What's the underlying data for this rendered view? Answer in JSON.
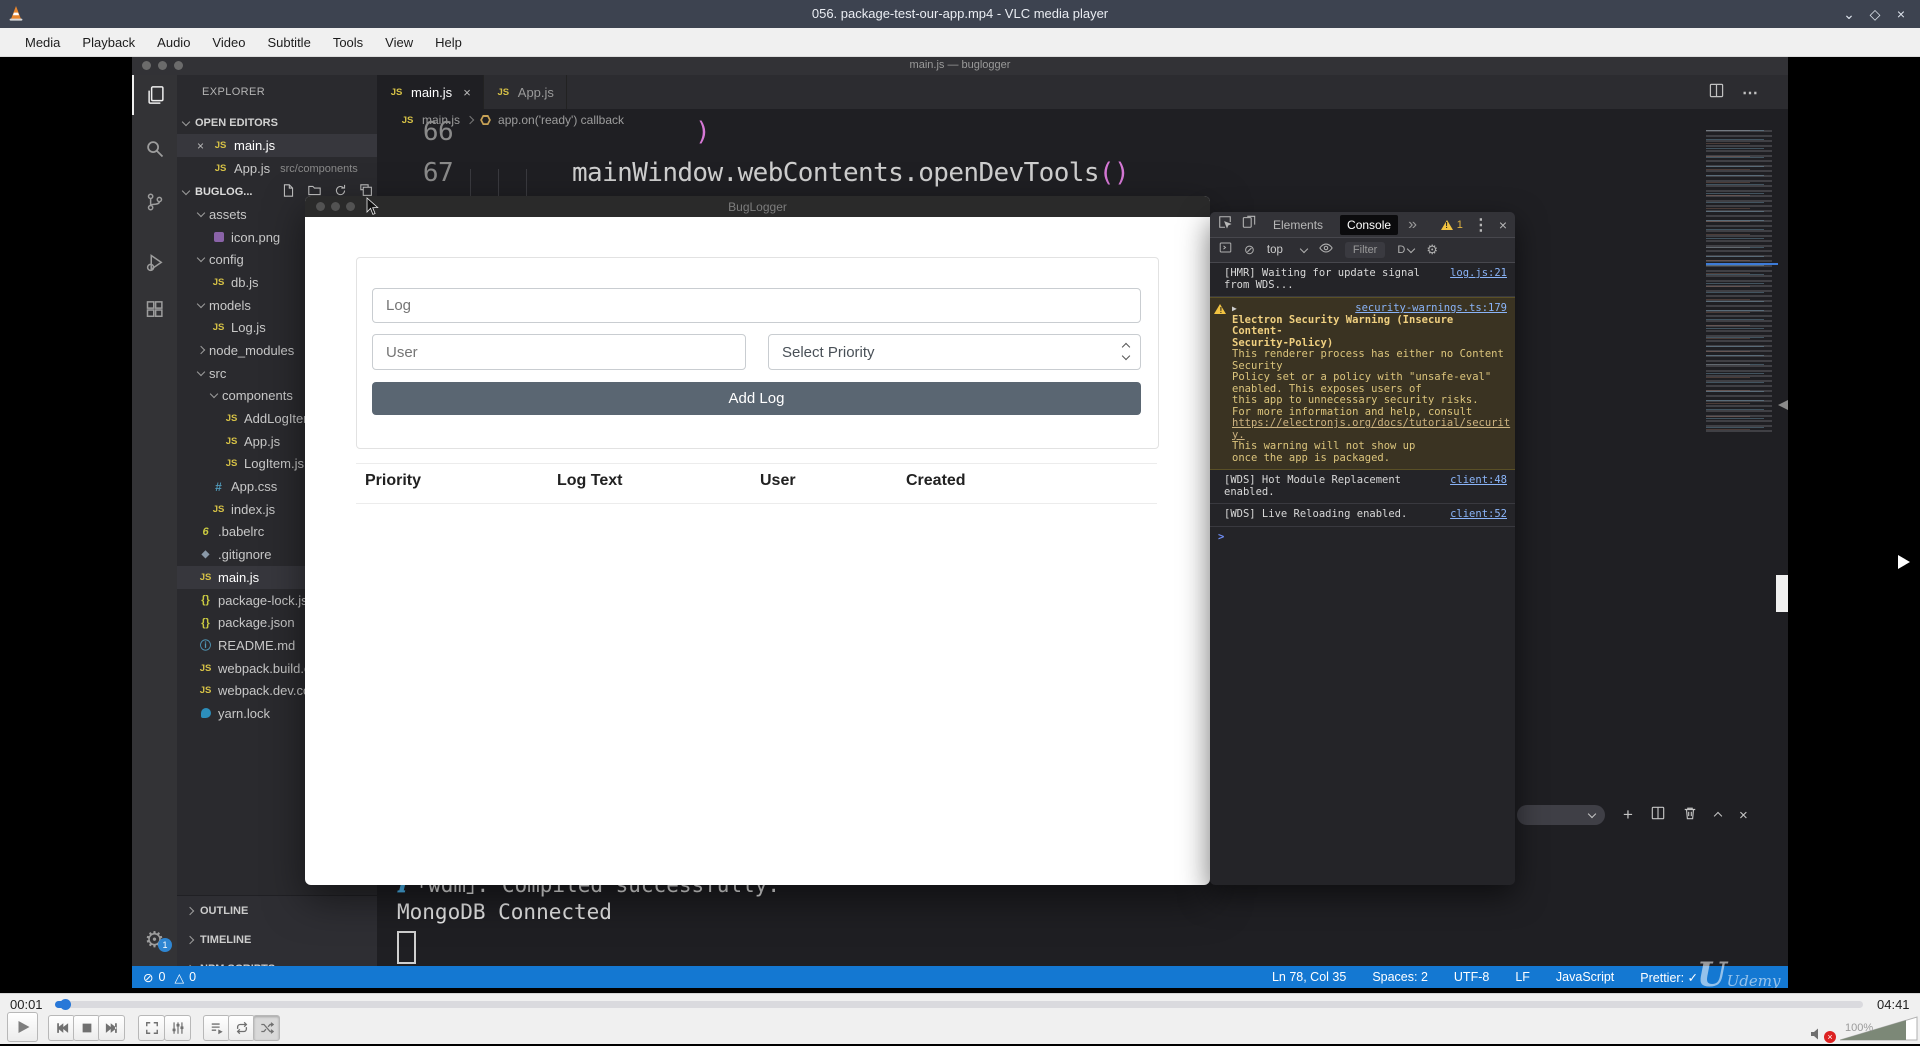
{
  "vlc": {
    "titlebar": {
      "title": "056. package-test-our-app.mp4 - VLC media player"
    },
    "window_controls": {
      "minimize": "⌄",
      "maximize": "◇",
      "close": "×"
    },
    "menu": [
      "Media",
      "Playback",
      "Audio",
      "Video",
      "Subtitle",
      "Tools",
      "View",
      "Help"
    ],
    "seek": {
      "current": "00:01",
      "total": "04:41"
    },
    "volume": {
      "label": "100%"
    }
  },
  "vscode": {
    "window_title": "main.js — buglogger",
    "explorer": {
      "title": "EXPLORER",
      "open_editors_label": "OPEN EDITORS",
      "open_editors": [
        {
          "name": "main.js",
          "path": ""
        },
        {
          "name": "App.js",
          "path": "src/components"
        }
      ],
      "project_label": "BUGLOG...",
      "tree": [
        {
          "name": "assets",
          "icon": "folder-open",
          "indent": 1
        },
        {
          "name": "icon.png",
          "icon": "image",
          "indent": 2
        },
        {
          "name": "config",
          "icon": "folder-open",
          "indent": 1
        },
        {
          "name": "db.js",
          "icon": "js",
          "indent": 2
        },
        {
          "name": "models",
          "icon": "folder-open",
          "indent": 1
        },
        {
          "name": "Log.js",
          "icon": "js",
          "indent": 2
        },
        {
          "name": "node_modules",
          "icon": "folder-closed",
          "indent": 1
        },
        {
          "name": "src",
          "icon": "folder-open",
          "indent": 1
        },
        {
          "name": "components",
          "icon": "folder-open",
          "indent": 2
        },
        {
          "name": "AddLogItem.",
          "icon": "js",
          "indent": 3
        },
        {
          "name": "App.js",
          "icon": "js",
          "indent": 3
        },
        {
          "name": "LogItem.js",
          "icon": "js",
          "indent": 3
        },
        {
          "name": "App.css",
          "icon": "css",
          "indent": 2
        },
        {
          "name": "index.js",
          "icon": "js",
          "indent": 2
        },
        {
          "name": ".babelrc",
          "icon": "babel",
          "indent": 1
        },
        {
          "name": ".gitignore",
          "icon": "git",
          "indent": 1
        },
        {
          "name": "main.js",
          "icon": "js",
          "indent": 1,
          "selected": true
        },
        {
          "name": "package-lock.js",
          "icon": "json",
          "indent": 1
        },
        {
          "name": "package.json",
          "icon": "json",
          "indent": 1
        },
        {
          "name": "README.md",
          "icon": "info",
          "indent": 1
        },
        {
          "name": "webpack.build.c",
          "icon": "js",
          "indent": 1
        },
        {
          "name": "webpack.dev.co",
          "icon": "js",
          "indent": 1
        },
        {
          "name": "yarn.lock",
          "icon": "yarn",
          "indent": 1
        }
      ],
      "sections": [
        "OUTLINE",
        "TIMELINE",
        "NPM SCRIPTS"
      ]
    },
    "tabs": [
      {
        "label": "main.js",
        "active": true
      },
      {
        "label": "App.js",
        "active": false
      }
    ],
    "breadcrumb": {
      "file": "main.js",
      "symbol": "app.on('ready') callback"
    },
    "code": {
      "lines": [
        {
          "num": "66",
          "text": ")"
        },
        {
          "num": "67",
          "text": "mainWindow.webContents.openDevTools()"
        }
      ]
    },
    "terminal": {
      "line1": "｢wdm｣: Compiled successfully.",
      "line2": "MongoDB Connected"
    },
    "status_bar": {
      "errors": "0",
      "warnings": "0",
      "items": [
        "Ln 78, Col 35",
        "Spaces: 2",
        "UTF-8",
        "LF",
        "JavaScript",
        "Prettier: ✓"
      ]
    },
    "watermark": {
      "initial": "U",
      "text": "Udemy"
    }
  },
  "buglogger": {
    "title": "BugLogger",
    "form": {
      "log_placeholder": "Log",
      "user_placeholder": "User",
      "priority_value": "Select Priority",
      "submit_label": "Add Log"
    },
    "table": {
      "headers": [
        "Priority",
        "Log Text",
        "User",
        "Created"
      ]
    }
  },
  "devtools": {
    "tabs": [
      "Elements",
      "Console"
    ],
    "active_tab": "Console",
    "more_tabs": "»",
    "warning_count": "1",
    "toolbar": {
      "context": "top",
      "filter_placeholder": "Filter",
      "levels": "D"
    },
    "messages": [
      {
        "type": "log",
        "source": "log.js:21",
        "lines": [
          "[HMR] Waiting for update signal",
          "from WDS..."
        ]
      },
      {
        "type": "warning",
        "source": "security-warnings.ts:179",
        "content": [
          {
            "s": "title",
            "t": "Electron Security Warning (Insecure Content-"
          },
          {
            "s": "title",
            "t": "Security-Policy)"
          },
          {
            "s": "body",
            "t": " This renderer process has either no Content"
          },
          {
            "s": "body",
            "t": "Security"
          },
          {
            "s": "body",
            "t": "    Policy set or a policy with \"unsafe-eval\""
          },
          {
            "s": "body",
            "t": "enabled. This exposes users of"
          },
          {
            "s": "body",
            "t": "    this app to unnecessary security risks."
          },
          {
            "s": "body",
            "t": " "
          },
          {
            "s": "body",
            "t": "For more information and help, consult"
          },
          {
            "s": "link",
            "t": "https://electronjs.org/docs/tutorial/securit"
          },
          {
            "s": "link",
            "t": "y."
          },
          {
            "s": "body",
            "t": "This warning will not show up"
          },
          {
            "s": "body",
            "t": "once the app is packaged."
          }
        ]
      },
      {
        "type": "log",
        "source": "client:48",
        "lines": [
          "[WDS] Hot Module Replacement",
          "enabled."
        ]
      },
      {
        "type": "log",
        "source": "client:52",
        "lines": [
          "[WDS] Live Reloading enabled."
        ]
      }
    ],
    "prompt": ">"
  }
}
